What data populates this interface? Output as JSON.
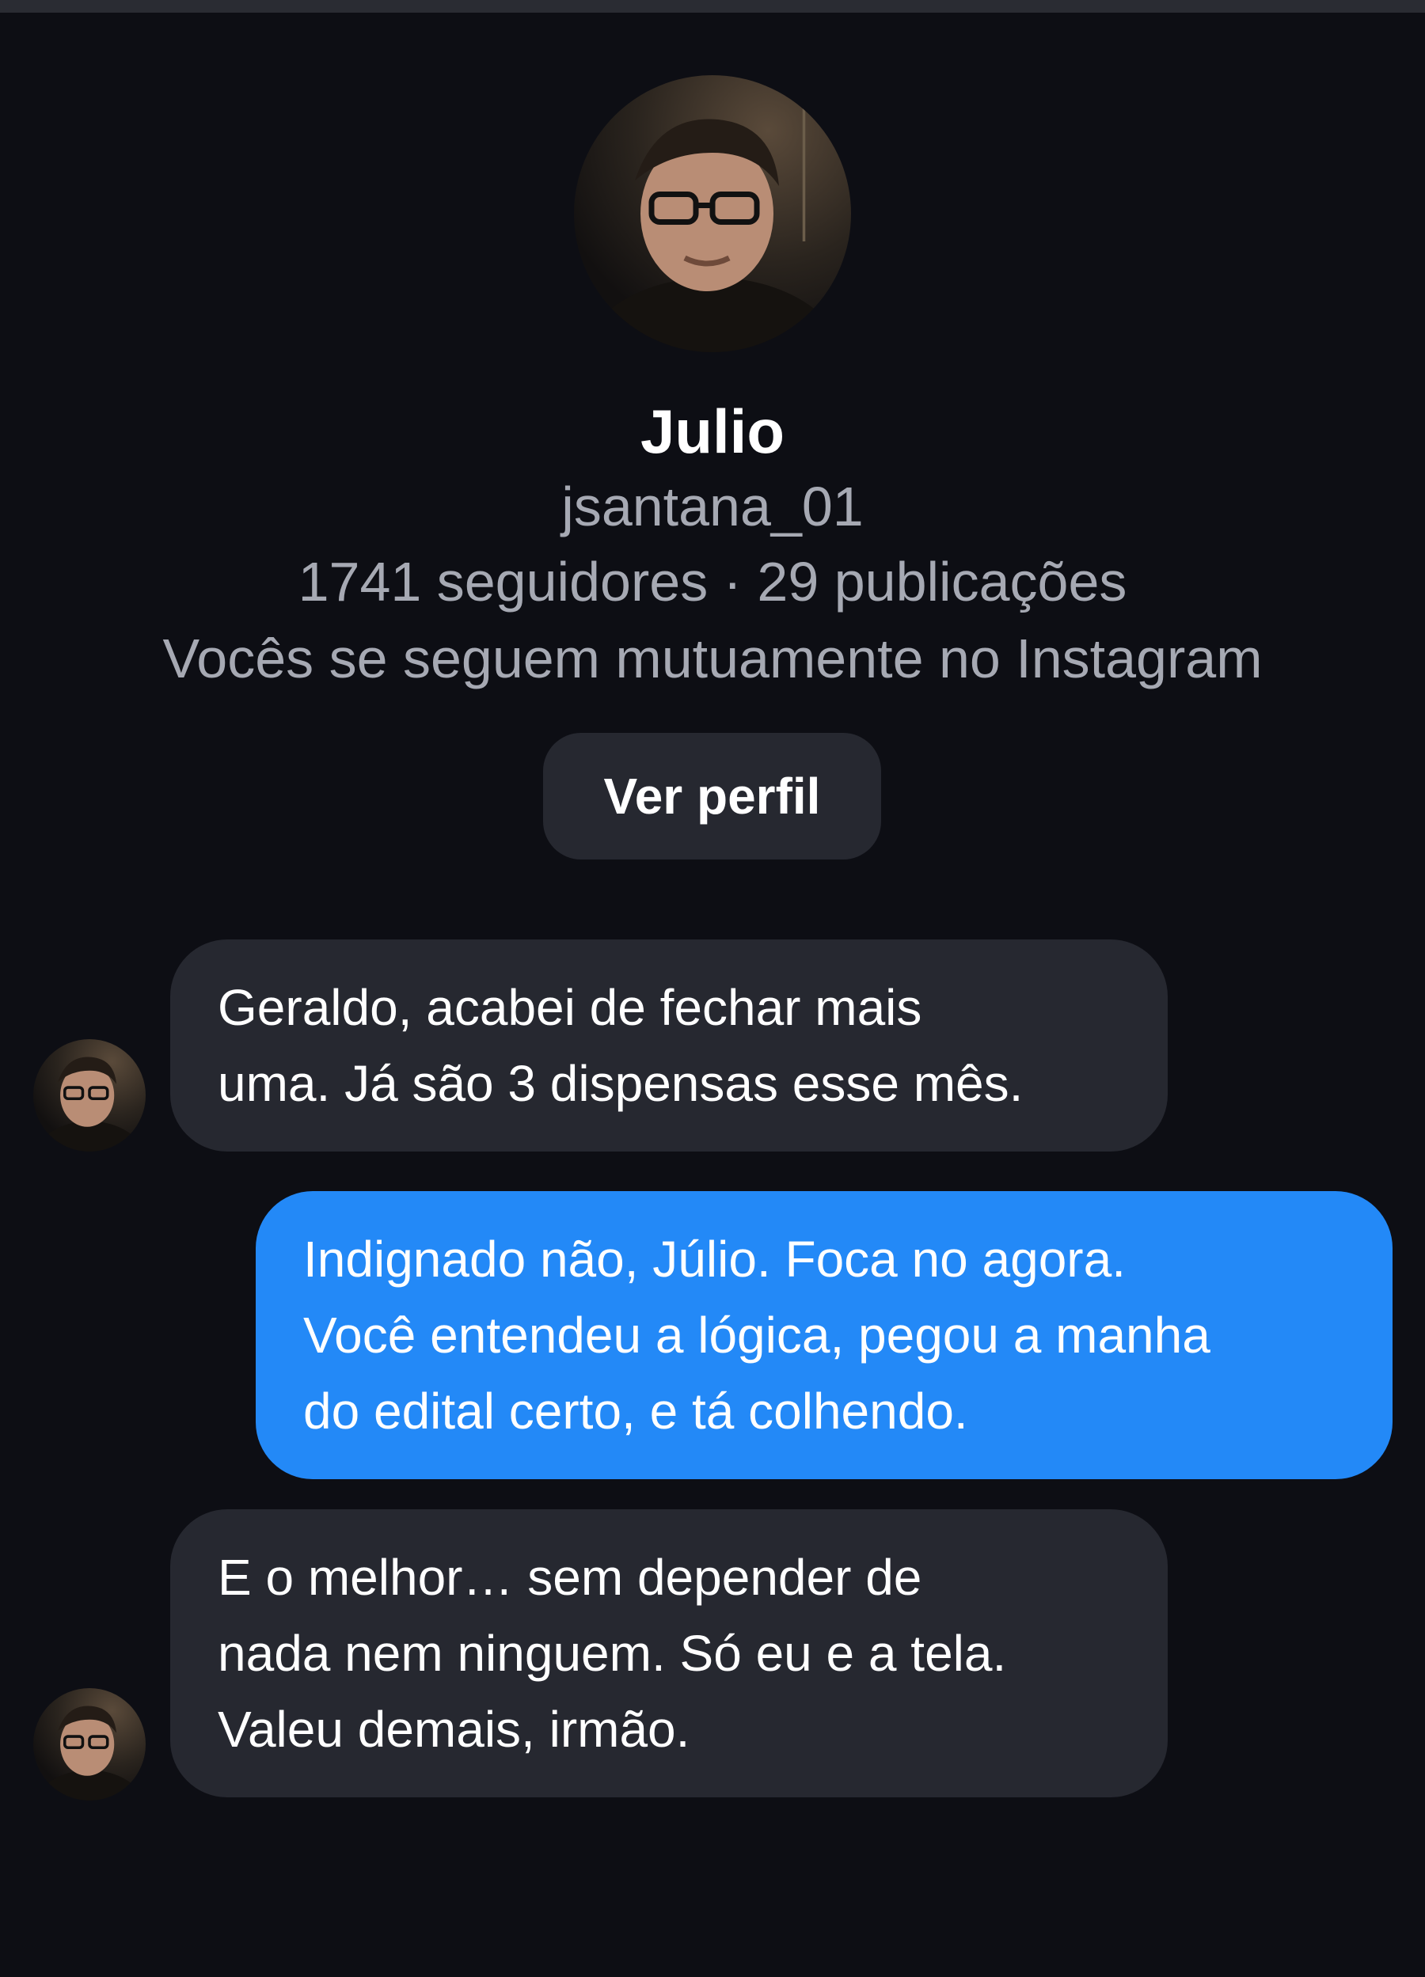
{
  "profile": {
    "name": "Julio",
    "username": "jsantana_01",
    "stats": "1741 seguidores · 29 publicações",
    "mutual_text": "Vocês se seguem mutuamente no Instagram",
    "view_profile_label": "Ver perfil"
  },
  "messages": [
    {
      "direction": "incoming",
      "lines": [
        "Geraldo, acabei de fechar mais",
        "uma. Já são 3 dispensas esse mês."
      ]
    },
    {
      "direction": "outgoing",
      "lines": [
        "Indignado não, Júlio. Foca no agora.",
        "Você entendeu a lógica, pegou a manha",
        "do edital certo, e tá colhendo."
      ]
    },
    {
      "direction": "incoming",
      "lines": [
        "E o melhor… sem depender de",
        "nada nem ninguem. Só eu e a tela.",
        "Valeu demais, irmão."
      ]
    }
  ],
  "colors": {
    "background": "#0d0e14",
    "incoming_bubble": "#262830",
    "outgoing_bubble": "#2389f7",
    "secondary_text": "#a6a9b3"
  },
  "icons": {
    "profile_avatar": "user-photo",
    "message_avatar": "user-photo"
  }
}
